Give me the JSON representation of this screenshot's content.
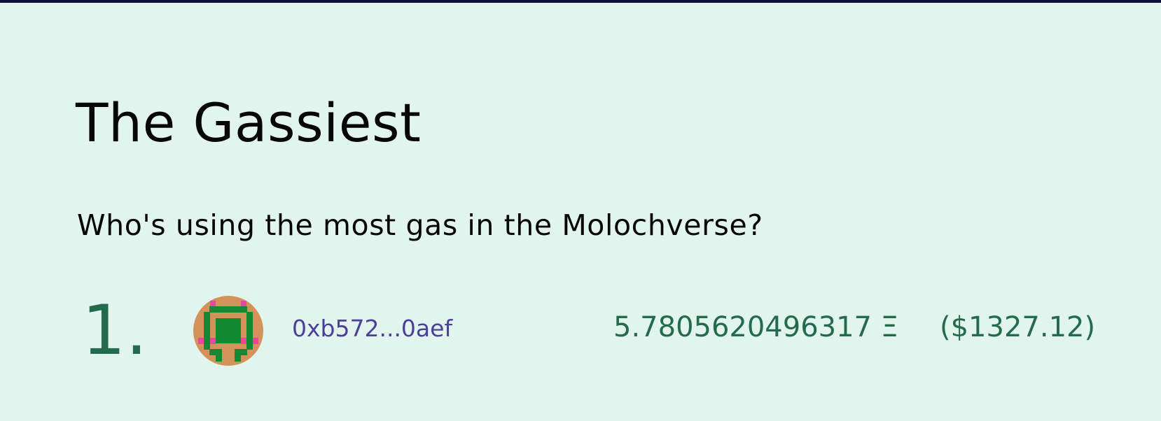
{
  "page": {
    "title": "The Gassiest",
    "subtitle": "Who's using the most gas in the Molochverse?"
  },
  "leaderboard": [
    {
      "rank": "1.",
      "address": "0xb572...0aef",
      "gas_eth": "5.7805620496317 Ξ",
      "gas_usd": "($1327.12)"
    }
  ],
  "colors": {
    "background": "#e2f4ee",
    "top_bar": "#0d0f3a",
    "accent_green": "#246b4e",
    "address_purple": "#4b3f98",
    "avatar_orange": "#d3925a",
    "avatar_green": "#138a31",
    "avatar_pink": "#e8489a"
  }
}
